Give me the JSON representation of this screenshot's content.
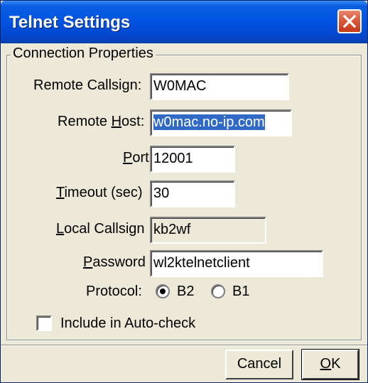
{
  "window": {
    "title": "Telnet Settings",
    "close_icon": "close-icon"
  },
  "group": {
    "legend": "Connection Properties"
  },
  "fields": {
    "remote_callsign": {
      "label": "Remote Callsign:",
      "value": "W0MAC"
    },
    "remote_host": {
      "label_pre": "Remote ",
      "label_u": "H",
      "label_post": "ost:",
      "value": "w0mac.no-ip.com",
      "selected": true
    },
    "port": {
      "label_pre": "",
      "label_u": "P",
      "label_post": "ort:",
      "value": "12001"
    },
    "timeout": {
      "label_pre": "",
      "label_u": "T",
      "label_post": "imeout (sec)",
      "value": "30"
    },
    "local_callsign": {
      "label_pre": "",
      "label_u": "L",
      "label_post": "ocal Callsign",
      "value": "kb2wf",
      "readonly": true
    },
    "password": {
      "label_pre": "",
      "label_u": "P",
      "label_post": "assword",
      "value": "wl2ktelnetclient"
    }
  },
  "protocol": {
    "label": "Protocol:",
    "options": [
      {
        "label": "B2",
        "checked": true
      },
      {
        "label": "B1",
        "checked": false
      }
    ]
  },
  "auto_check": {
    "label": "Include in Auto-check",
    "checked": false
  },
  "buttons": {
    "cancel": "Cancel",
    "ok_u": "O",
    "ok_post": "K"
  }
}
